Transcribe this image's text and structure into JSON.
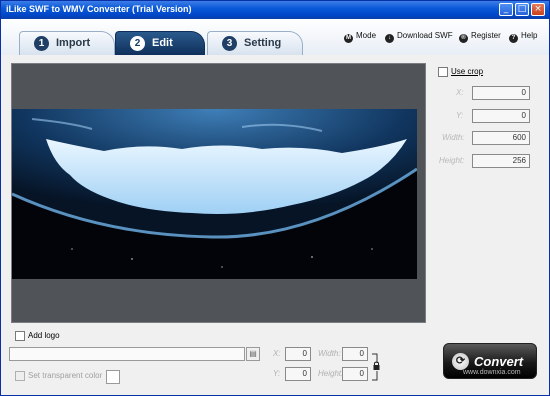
{
  "window": {
    "title": "iLike SWF to WMV Converter (Trial Version)",
    "minimize_glyph": "_",
    "restore_glyph": "□",
    "close_glyph": "×"
  },
  "tabs": [
    {
      "num": "1",
      "label": "Import",
      "active": false
    },
    {
      "num": "2",
      "label": "Edit",
      "active": true
    },
    {
      "num": "3",
      "label": "Setting",
      "active": false
    }
  ],
  "toplinks": {
    "mode": {
      "icon": "M",
      "label": "Mode"
    },
    "download": {
      "icon": "↓",
      "label": "Download SWF"
    },
    "register": {
      "icon": "®",
      "label": "Register"
    },
    "help": {
      "icon": "?",
      "label": "Help"
    }
  },
  "crop": {
    "use_crop_label": "Use crop",
    "x_label": "X:",
    "x_value": "0",
    "y_label": "Y:",
    "y_value": "0",
    "width_label": "Width:",
    "width_value": "600",
    "height_label": "Height:",
    "height_value": "256"
  },
  "logo": {
    "add_logo_label": "Add logo",
    "file_path": "",
    "transparent_label": "Set transparent color",
    "x_label": "X:",
    "x_value": "0",
    "y_label": "Y:",
    "y_value": "0",
    "width_label": "Width:",
    "width_value": "0",
    "height_label": "Height:",
    "height_value": "0"
  },
  "convert_label": "Convert",
  "watermark": "www.downxia.com",
  "colors": {
    "accent": "#0f2f5a",
    "titlebar": "#0a5ad8",
    "preview_bg": "#505459"
  }
}
